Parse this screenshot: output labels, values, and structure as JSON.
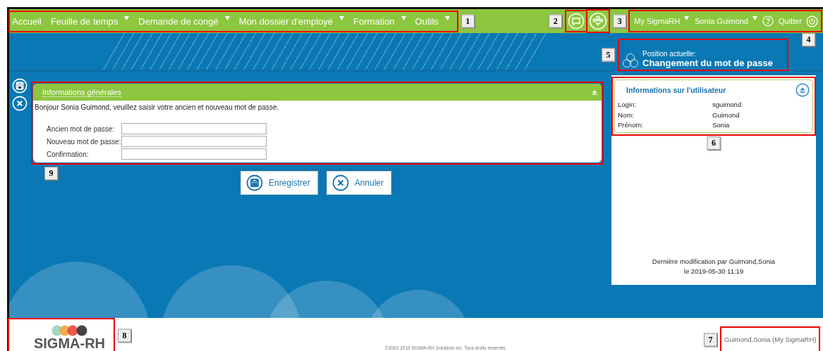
{
  "nav": {
    "callout": "1",
    "items": [
      {
        "label": "Accueil",
        "has_menu": false
      },
      {
        "label": "Feuille de temps",
        "has_menu": true
      },
      {
        "label": "Demande de congé",
        "has_menu": true
      },
      {
        "label": "Mon dossier d'employé",
        "has_menu": true
      },
      {
        "label": "Formation",
        "has_menu": true
      },
      {
        "label": "Outils",
        "has_menu": true
      }
    ]
  },
  "tools": [
    {
      "kind": "chat",
      "callout": "2"
    },
    {
      "kind": "org",
      "callout": "3"
    }
  ],
  "user_menu": {
    "callout": "4",
    "items": [
      {
        "label": "My SigmaRH",
        "has_menu": true
      },
      {
        "label": "Sonia Guimond",
        "has_menu": true
      }
    ],
    "quit": "Quitter"
  },
  "position": {
    "callout": "5",
    "label": "Position actuelle:",
    "title": "Changement du mot de passe"
  },
  "panel": {
    "callout": "9",
    "title": "Informations générales",
    "greeting": "Bonjour Sonia Guimond, veuillez saisir votre ancien et nouveau mot de passe.",
    "fields": [
      {
        "label": "Ancien mot de passe:"
      },
      {
        "label": "Nouveau mot de passe:"
      },
      {
        "label": "Confirmation:"
      }
    ]
  },
  "buttons": [
    {
      "kind": "save",
      "label": "Enregistrer"
    },
    {
      "kind": "cancel",
      "label": "Annuler"
    }
  ],
  "user_info": {
    "callout": "6",
    "title": "Informations sur l'utilisateur",
    "rows": [
      {
        "label": "Login:",
        "value": "sguimond"
      },
      {
        "label": "Nom:",
        "value": "Guimond"
      },
      {
        "label": "Prénom:",
        "value": "Sonia"
      }
    ]
  },
  "modified": [
    "Dernière modification par Guimond,Sonia",
    "le 2019-05-30 11:19"
  ],
  "footer": {
    "logo": {
      "callout": "8",
      "text": "SIGMA-RH"
    },
    "copyright": "©2002-2019 SIGMA-RH Solutions inc. Tous droits réservés.",
    "user": {
      "callout": "7",
      "text": "Guimond,Sonia (My SigmaRH)"
    }
  }
}
